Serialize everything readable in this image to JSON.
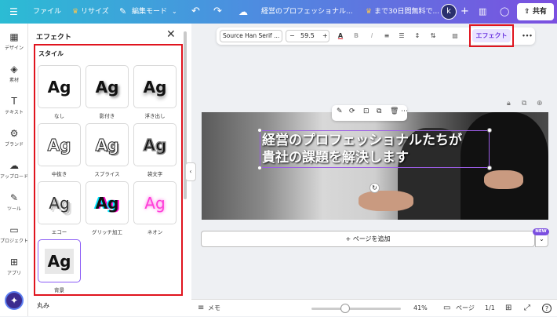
{
  "topbar": {
    "menu_icon": "hamburger-icon",
    "file_label": "ファイル",
    "resize_label": "リサイズ",
    "edit_mode_label": "編集モード",
    "doc_title": "経営のプロフェッショナル...",
    "trial_label": "まで30日間無料で...",
    "avatar_letter": "k",
    "share_label": "共有"
  },
  "leftrail": {
    "items": [
      {
        "label": "デザイン",
        "icon": "layout-icon"
      },
      {
        "label": "素材",
        "icon": "shapes-icon"
      },
      {
        "label": "テキスト",
        "icon": "text-icon"
      },
      {
        "label": "ブランド",
        "icon": "brand-icon"
      },
      {
        "label": "アップロード",
        "icon": "upload-icon"
      },
      {
        "label": "ツール",
        "icon": "pen-icon"
      },
      {
        "label": "プロジェクト",
        "icon": "folder-icon"
      },
      {
        "label": "アプリ",
        "icon": "apps-icon"
      }
    ]
  },
  "panel": {
    "title": "エフェクト",
    "style_section": "スタイル",
    "round_section": "丸み",
    "styles": [
      {
        "sample": "Ag",
        "label": "なし"
      },
      {
        "sample": "Ag",
        "label": "影付き"
      },
      {
        "sample": "Ag",
        "label": "浮き出し"
      },
      {
        "sample": "Ag",
        "label": "中抜き"
      },
      {
        "sample": "Ag",
        "label": "スプライス"
      },
      {
        "sample": "Ag",
        "label": "袋文字"
      },
      {
        "sample": "Ag",
        "label": "エコー"
      },
      {
        "sample": "Ag",
        "label": "グリッチ加工"
      },
      {
        "sample": "Ag",
        "label": "ネオン"
      },
      {
        "sample": "Ag",
        "label": "背景",
        "selected": true
      }
    ]
  },
  "toolbar": {
    "font_name": "Source Han Serif ...",
    "minus": "−",
    "font_size": "59.5",
    "plus": "+",
    "bold": "B",
    "italic": "I",
    "effect_label": "エフェクト",
    "more": "•••"
  },
  "canvas": {
    "headline_line1": "経営のプロフェッショナルたちが",
    "headline_line2": "貴社の課題を解決します"
  },
  "addpage": {
    "label": "+ ページを追加",
    "new_badge": "NEW"
  },
  "bottombar": {
    "notes_label": "メモ",
    "zoom": "41%",
    "zoom_level": 0.41,
    "pages_label": "ページ",
    "page_count": "1/1",
    "help": "?"
  },
  "colors": {
    "accent": "#7b4fe0",
    "highlight_red": "#e0141e"
  }
}
